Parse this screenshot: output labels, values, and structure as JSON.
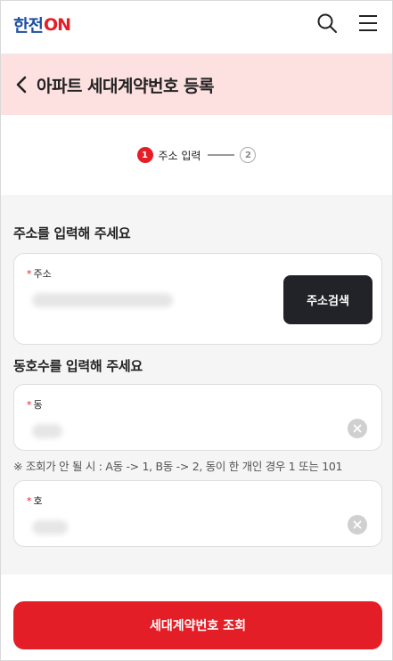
{
  "header": {
    "logo_text_a": "한전",
    "logo_text_b": "ON",
    "icons": [
      "search-icon",
      "menu-icon"
    ]
  },
  "titlebar": {
    "title": "아파트 세대계약번호 등록"
  },
  "steps": [
    {
      "number": "1",
      "label": "주소 입력",
      "active": true
    },
    {
      "number": "2",
      "label": "",
      "active": false
    }
  ],
  "address_section": {
    "title": "주소를 입력해 주세요",
    "required_mark": "*",
    "label": "주소",
    "search_button": "주소검색"
  },
  "unit_section": {
    "title": "동호수를 입력해 주세요",
    "dong_label": "동",
    "ho_label": "호",
    "required_mark": "*",
    "hint": "※ 조회가 안 될 시 : A동 -> 1, B동 -> 2, 동이 한 개인 경우 1 또는 101"
  },
  "submit": {
    "label": "세대계약번호 조회"
  },
  "colors": {
    "brand_red": "#e41e26",
    "brand_blue": "#1f4fa3",
    "title_bg": "#fde0e0",
    "dark_button": "#222329"
  }
}
